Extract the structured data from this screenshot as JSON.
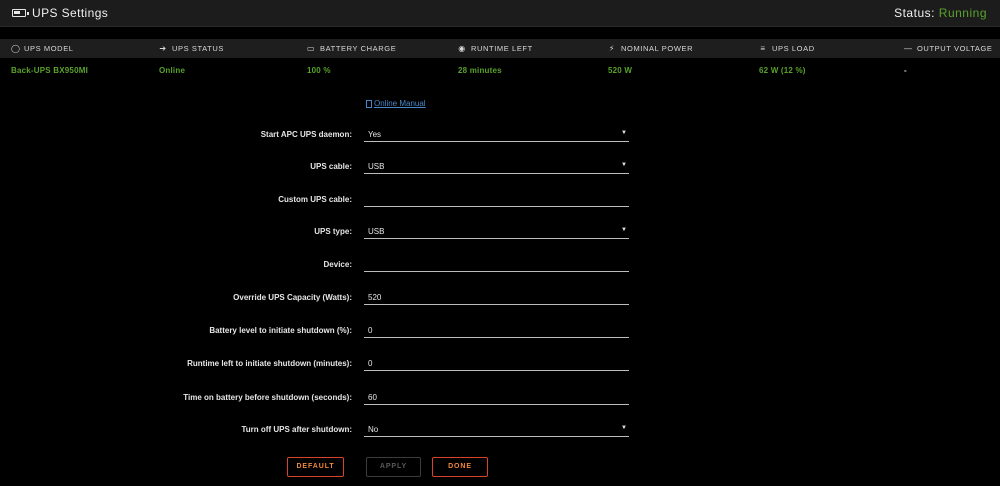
{
  "titlebar": {
    "title": "UPS Settings",
    "status_label": "Status:",
    "status_value": "Running"
  },
  "summary": {
    "headers": [
      {
        "label": "UPS MODEL",
        "icon": "shield-icon"
      },
      {
        "label": "UPS STATUS",
        "icon": "plug-icon"
      },
      {
        "label": "BATTERY CHARGE",
        "icon": "battery-icon"
      },
      {
        "label": "RUNTIME LEFT",
        "icon": "clock-icon"
      },
      {
        "label": "NOMINAL POWER",
        "icon": "bolt-icon"
      },
      {
        "label": "UPS LOAD",
        "icon": "bars-icon"
      },
      {
        "label": "OUTPUT VOLTAGE",
        "icon": "minus-icon"
      }
    ],
    "values": [
      "Back-UPS BX950MI",
      "Online",
      "100 %",
      "28 minutes",
      "520 W",
      "62 W (12 %)",
      "-"
    ]
  },
  "manual_link": "Online Manual",
  "form": [
    {
      "label": "Start APC UPS daemon:",
      "value": "Yes",
      "type": "select"
    },
    {
      "label": "UPS cable:",
      "value": "USB",
      "type": "select"
    },
    {
      "label": "Custom UPS cable:",
      "value": "",
      "type": "input"
    },
    {
      "label": "UPS type:",
      "value": "USB",
      "type": "select"
    },
    {
      "label": "Device:",
      "value": "",
      "type": "input"
    },
    {
      "label": "Override UPS Capacity (Watts):",
      "value": "520",
      "type": "input"
    },
    {
      "label": "Battery level to initiate shutdown (%):",
      "value": "0",
      "type": "input"
    },
    {
      "label": "Runtime left to initiate shutdown (minutes):",
      "value": "0",
      "type": "input"
    },
    {
      "label": "Time on battery before shutdown (seconds):",
      "value": "60",
      "type": "input"
    },
    {
      "label": "Turn off UPS after shutdown:",
      "value": "No",
      "type": "select"
    }
  ],
  "buttons": {
    "default": "DEFAULT",
    "apply": "APPLY",
    "done": "DONE"
  },
  "colors": {
    "accent_green": "#5aa22b",
    "button_orange": "#d8442a",
    "link_blue": "#4a87c9"
  }
}
